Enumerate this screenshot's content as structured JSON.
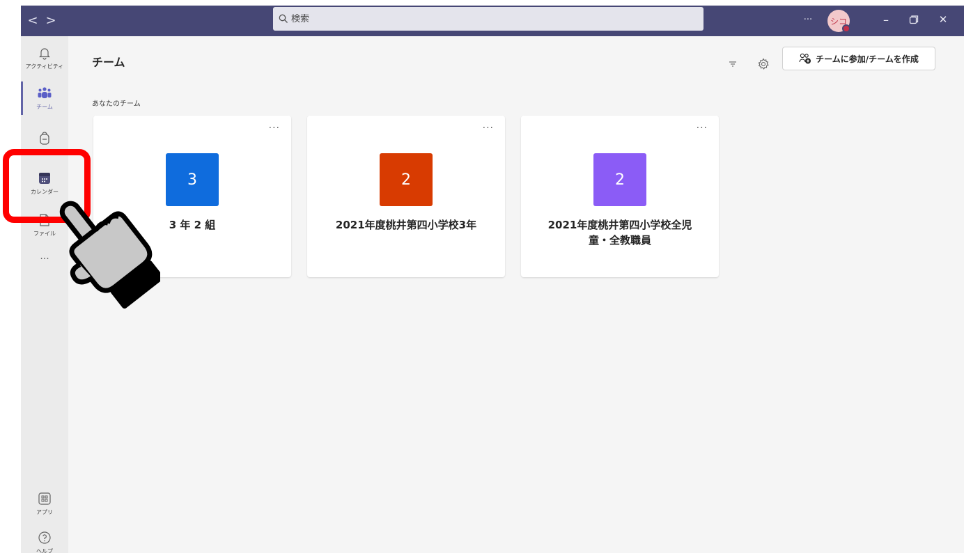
{
  "titlebar": {
    "back": "<",
    "forward": ">",
    "search_placeholder": "検索",
    "more": "···",
    "avatar_initials": "シコ",
    "minimize": "–",
    "restore": "❐",
    "close": "✕"
  },
  "rail": {
    "items": [
      {
        "label": "アクティビティ",
        "icon": "bell-icon"
      },
      {
        "label": "チーム",
        "icon": "teams-icon",
        "active": true
      },
      {
        "label": "",
        "icon": "backpack-icon"
      },
      {
        "label": "カレンダー",
        "icon": "calendar-icon"
      },
      {
        "label": "ファイル",
        "icon": "file-icon"
      },
      {
        "label": "···",
        "icon": "more-icon"
      }
    ],
    "bottom": [
      {
        "label": "アプリ",
        "icon": "apps-icon"
      },
      {
        "label": "ヘルプ",
        "icon": "help-icon"
      }
    ]
  },
  "main": {
    "title": "チーム",
    "section_label": "あなたのチーム",
    "join_button": "チームに参加/チームを作成",
    "teams": [
      {
        "tile": "3",
        "name": "3 年 2 組",
        "color": "#0f6cdd"
      },
      {
        "tile": "2",
        "name": "2021年度桃井第四小学校3年",
        "color": "#d83b01"
      },
      {
        "tile": "2",
        "name": "2021年度桃井第四小学校全児童・全教職員",
        "color": "#8b5cf6"
      }
    ],
    "card_more": "···"
  },
  "colors": {
    "titlebar": "#464775",
    "accent": "#6264a7",
    "highlight": "#ff0000"
  }
}
